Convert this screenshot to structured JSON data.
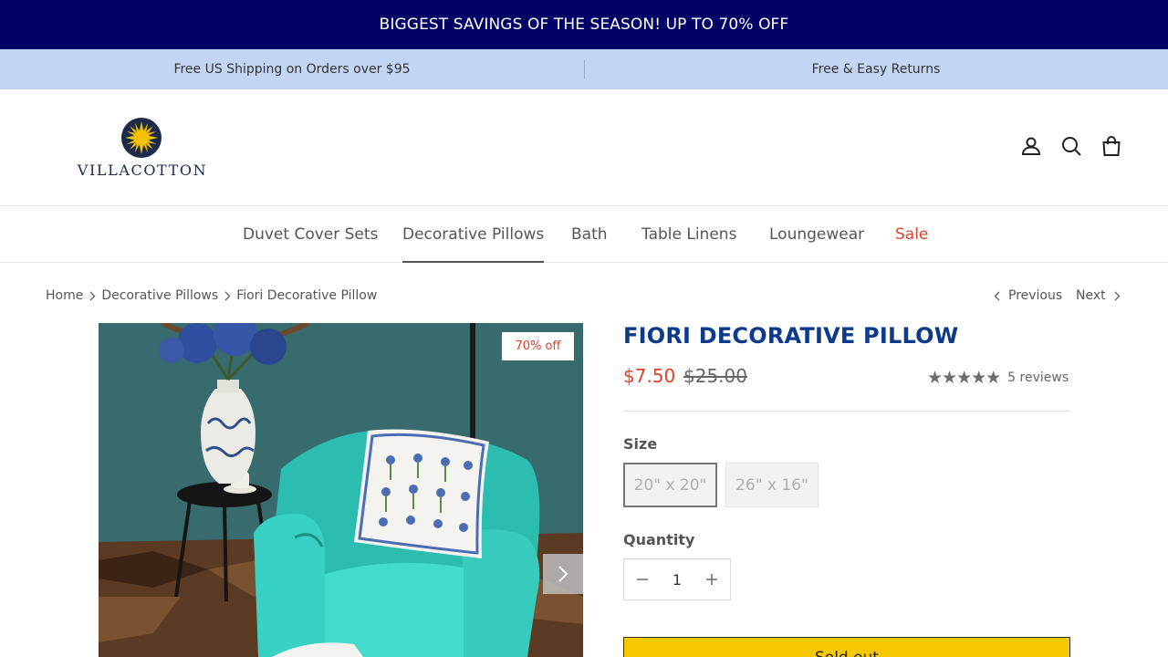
{
  "announcement": "BIGGEST SAVINGS OF THE SEASON! UP TO 70% OFF",
  "usp": [
    "Free US Shipping on Orders over $95",
    "Free & Easy Returns"
  ],
  "brand": {
    "name": "VILLACOTTON",
    "logo_colors": {
      "navy": "#1d2a4a",
      "sun": "#f5c200"
    }
  },
  "header_icons": [
    "account-icon",
    "search-icon",
    "cart-icon"
  ],
  "nav": [
    {
      "label": "Duvet Cover Sets"
    },
    {
      "label": "Decorative Pillows",
      "active": true
    },
    {
      "label": "Bath"
    },
    {
      "label": "Table Linens"
    },
    {
      "label": "Loungewear"
    },
    {
      "label": "Sale",
      "color": "#e0412b"
    }
  ],
  "breadcrumb": [
    "Home",
    "Decorative Pillows",
    "Fiori Decorative Pillow"
  ],
  "pager": {
    "previous": "Previous",
    "next": "Next"
  },
  "product": {
    "badge": "70% off",
    "title": "FIORI DECORATIVE PILLOW",
    "price": "$7.50",
    "compare_price": "$25.00",
    "rating": 5,
    "stars": "★★★★★",
    "reviews": "5 reviews",
    "size_label": "Size",
    "sizes": [
      {
        "label": "20\" x 20\"",
        "selected": true
      },
      {
        "label": "26\" x 16\""
      }
    ],
    "quantity_label": "Quantity",
    "quantity": "1",
    "cta": "Sold out"
  },
  "colors": {
    "announcement_bg": "#000066",
    "usp_bg": "#c2d6f4",
    "title": "#0e3a8c",
    "sale": "#e0412b",
    "cta_bg": "#f5c800"
  }
}
